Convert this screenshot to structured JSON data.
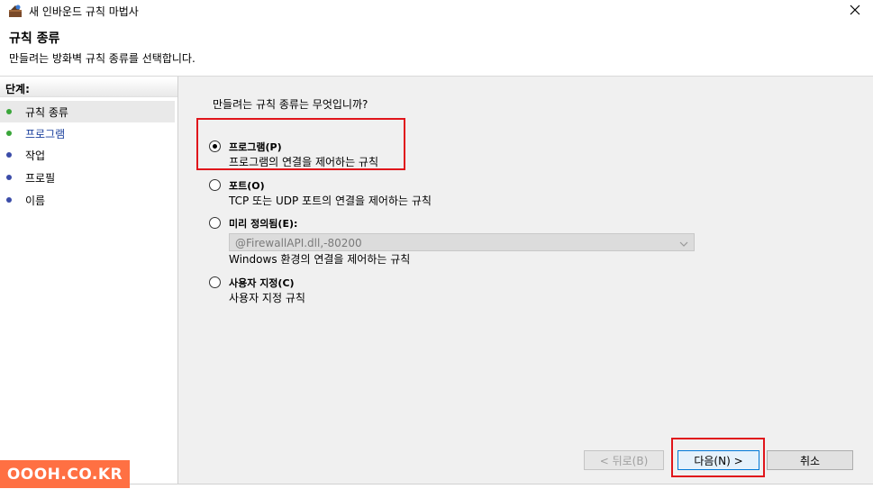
{
  "window": {
    "title": "새 인바운드 규칙 마법사",
    "icon": "firewall-wizard-icon",
    "close_icon": "close-icon"
  },
  "header": {
    "title": "규칙 종류",
    "subtitle": "만들려는 방화벽 규칙 종류를 선택합니다."
  },
  "steps": {
    "title": "단계:",
    "items": [
      {
        "label": "규칙 종류",
        "status_color": "#3aa63a",
        "active": true
      },
      {
        "label": "프로그램",
        "status_color": "#3aa63a",
        "active": false,
        "link_color": "#1a3f9c"
      },
      {
        "label": "작업",
        "status_color": "#3b4ca8",
        "active": false
      },
      {
        "label": "프로필",
        "status_color": "#3b4ca8",
        "active": false
      },
      {
        "label": "이름",
        "status_color": "#3b4ca8",
        "active": false
      }
    ]
  },
  "main": {
    "question": "만들려는 규칙 종류는 무엇입니까?",
    "options": [
      {
        "label": "프로그램(P)",
        "desc": "프로그램의 연결을 제어하는 규칙",
        "checked": true
      },
      {
        "label": "포트(O)",
        "desc": "TCP 또는 UDP 포트의 연결을 제어하는 규칙",
        "checked": false
      },
      {
        "label": "미리 정의됨(E):",
        "desc": "Windows 환경의 연결을 제어하는 규칙",
        "checked": false
      },
      {
        "label": "사용자 지정(C)",
        "desc": "사용자 지정 규칙",
        "checked": false
      }
    ],
    "predefined_combo": {
      "value": "@FirewallAPI.dll,-80200",
      "disabled": true
    }
  },
  "buttons": {
    "back": "< 뒤로(B)",
    "next": "다음(N) >",
    "cancel": "취소"
  },
  "watermark": "OOOH.CO.KR",
  "colors": {
    "highlight": "#e0151b",
    "watermark_bg": "#ff7043"
  }
}
